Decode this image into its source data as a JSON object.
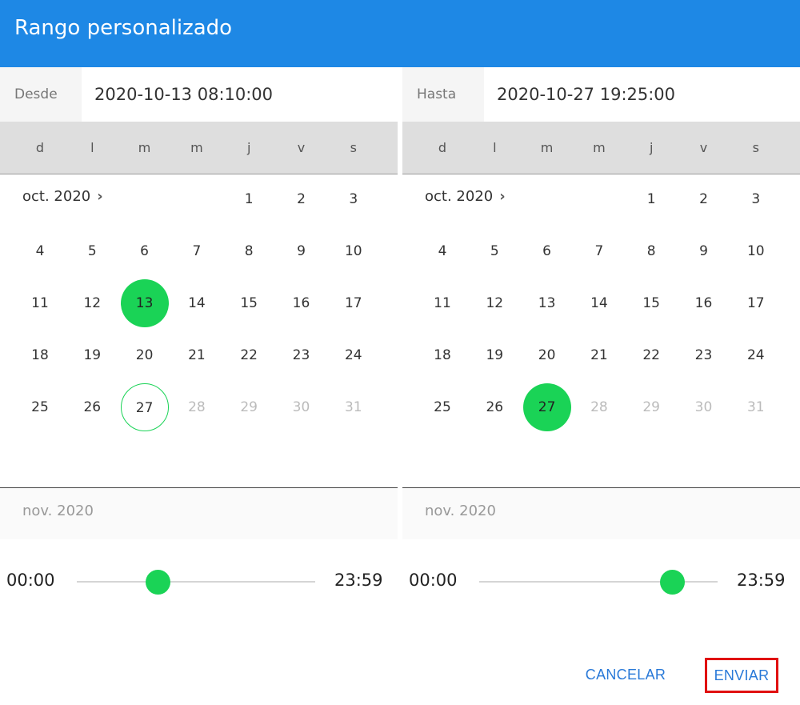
{
  "dialog": {
    "title": "Rango personalizado"
  },
  "accent": {
    "header": "#1e88e5",
    "selected": "#1ad356",
    "action": "#2979d8"
  },
  "from": {
    "label": "Desde",
    "value": "2020-10-13 08:10:00",
    "weekdays": [
      "d",
      "l",
      "m",
      "m",
      "j",
      "v",
      "s"
    ],
    "month_label": "oct. 2020",
    "next_month_label": "nov. 2020",
    "weeks": [
      [
        "",
        "",
        "",
        "",
        "1",
        "2",
        "3"
      ],
      [
        "4",
        "5",
        "6",
        "7",
        "8",
        "9",
        "10"
      ],
      [
        "11",
        "12",
        "13",
        "14",
        "15",
        "16",
        "17"
      ],
      [
        "18",
        "19",
        "20",
        "21",
        "22",
        "23",
        "24"
      ],
      [
        "25",
        "26",
        "27",
        "28",
        "29",
        "30",
        "31"
      ]
    ],
    "selected_day": "13",
    "today": "27",
    "time_min": "00:00",
    "time_max": "23:59",
    "time_value": "08:10"
  },
  "to": {
    "label": "Hasta",
    "value": "2020-10-27 19:25:00",
    "weekdays": [
      "d",
      "l",
      "m",
      "m",
      "j",
      "v",
      "s"
    ],
    "month_label": "oct. 2020",
    "next_month_label": "nov. 2020",
    "weeks": [
      [
        "",
        "",
        "",
        "",
        "1",
        "2",
        "3"
      ],
      [
        "4",
        "5",
        "6",
        "7",
        "8",
        "9",
        "10"
      ],
      [
        "11",
        "12",
        "13",
        "14",
        "15",
        "16",
        "17"
      ],
      [
        "18",
        "19",
        "20",
        "21",
        "22",
        "23",
        "24"
      ],
      [
        "25",
        "26",
        "27",
        "28",
        "29",
        "30",
        "31"
      ]
    ],
    "selected_day": "27",
    "today": "27",
    "time_min": "00:00",
    "time_max": "23:59",
    "time_value": "19:25"
  },
  "future_days": [
    "28",
    "29",
    "30",
    "31"
  ],
  "actions": {
    "cancel": "CANCELAR",
    "submit": "ENVIAR"
  }
}
